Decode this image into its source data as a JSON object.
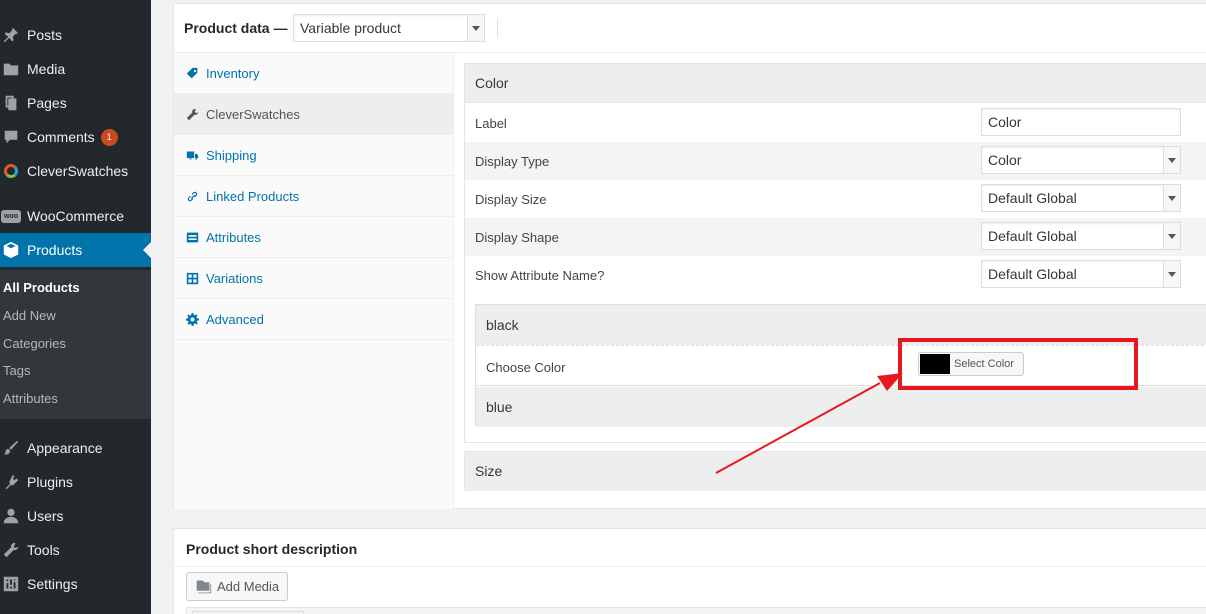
{
  "admin_menu": {
    "items": [
      {
        "label": "Posts",
        "icon": "pin-icon"
      },
      {
        "label": "Media",
        "icon": "media-icon"
      },
      {
        "label": "Pages",
        "icon": "pages-icon"
      },
      {
        "label": "Comments",
        "icon": "comment-icon",
        "badge": "1"
      },
      {
        "label": "CleverSwatches",
        "icon": "cleverswatches-logo-icon"
      },
      {
        "label": "WooCommerce",
        "icon": "woocommerce-logo-icon",
        "logo_text": "woo"
      },
      {
        "label": "Products",
        "icon": "products-box-icon"
      },
      {
        "label": "Appearance",
        "icon": "paintbrush-icon"
      },
      {
        "label": "Plugins",
        "icon": "plugin-icon"
      },
      {
        "label": "Users",
        "icon": "users-icon"
      },
      {
        "label": "Tools",
        "icon": "wrench-icon"
      },
      {
        "label": "Settings",
        "icon": "settings-sliders-icon"
      }
    ],
    "current": "Products",
    "submenu": [
      "All Products",
      "Add New",
      "Categories",
      "Tags",
      "Attributes"
    ],
    "submenu_current": "All Products"
  },
  "product_data": {
    "title": "Product data —",
    "type_select": "Variable product",
    "tabs": [
      {
        "label": "Inventory",
        "icon": "tag-icon"
      },
      {
        "label": "CleverSwatches",
        "icon": "wrench-icon"
      },
      {
        "label": "Shipping",
        "icon": "truck-icon"
      },
      {
        "label": "Linked Products",
        "icon": "link-icon"
      },
      {
        "label": "Attributes",
        "icon": "list-icon"
      },
      {
        "label": "Variations",
        "icon": "grid-icon"
      },
      {
        "label": "Advanced",
        "icon": "gear-icon"
      }
    ],
    "active_tab": "CleverSwatches",
    "color_attribute": {
      "heading": "Color",
      "rows": [
        {
          "label": "Label",
          "value": "Color",
          "control": "text"
        },
        {
          "label": "Display Type",
          "value": "Color",
          "control": "select"
        },
        {
          "label": "Display Size",
          "value": "Default Global",
          "control": "select"
        },
        {
          "label": "Display Shape",
          "value": "Default Global",
          "control": "select"
        },
        {
          "label": "Show Attribute Name?",
          "value": "Default Global",
          "control": "select"
        }
      ],
      "terms": [
        {
          "name": "black",
          "field_label": "Choose Color",
          "button_label": "Select Color",
          "swatch_color": "#000000"
        },
        {
          "name": "blue"
        }
      ]
    },
    "size_attribute": {
      "heading": "Size"
    }
  },
  "short_description": {
    "title": "Product short description",
    "add_media_label": "Add Media"
  },
  "colors": {
    "sidebar_bg": "#23282d",
    "accent": "#0073aa",
    "highlight": "#e8171d"
  }
}
